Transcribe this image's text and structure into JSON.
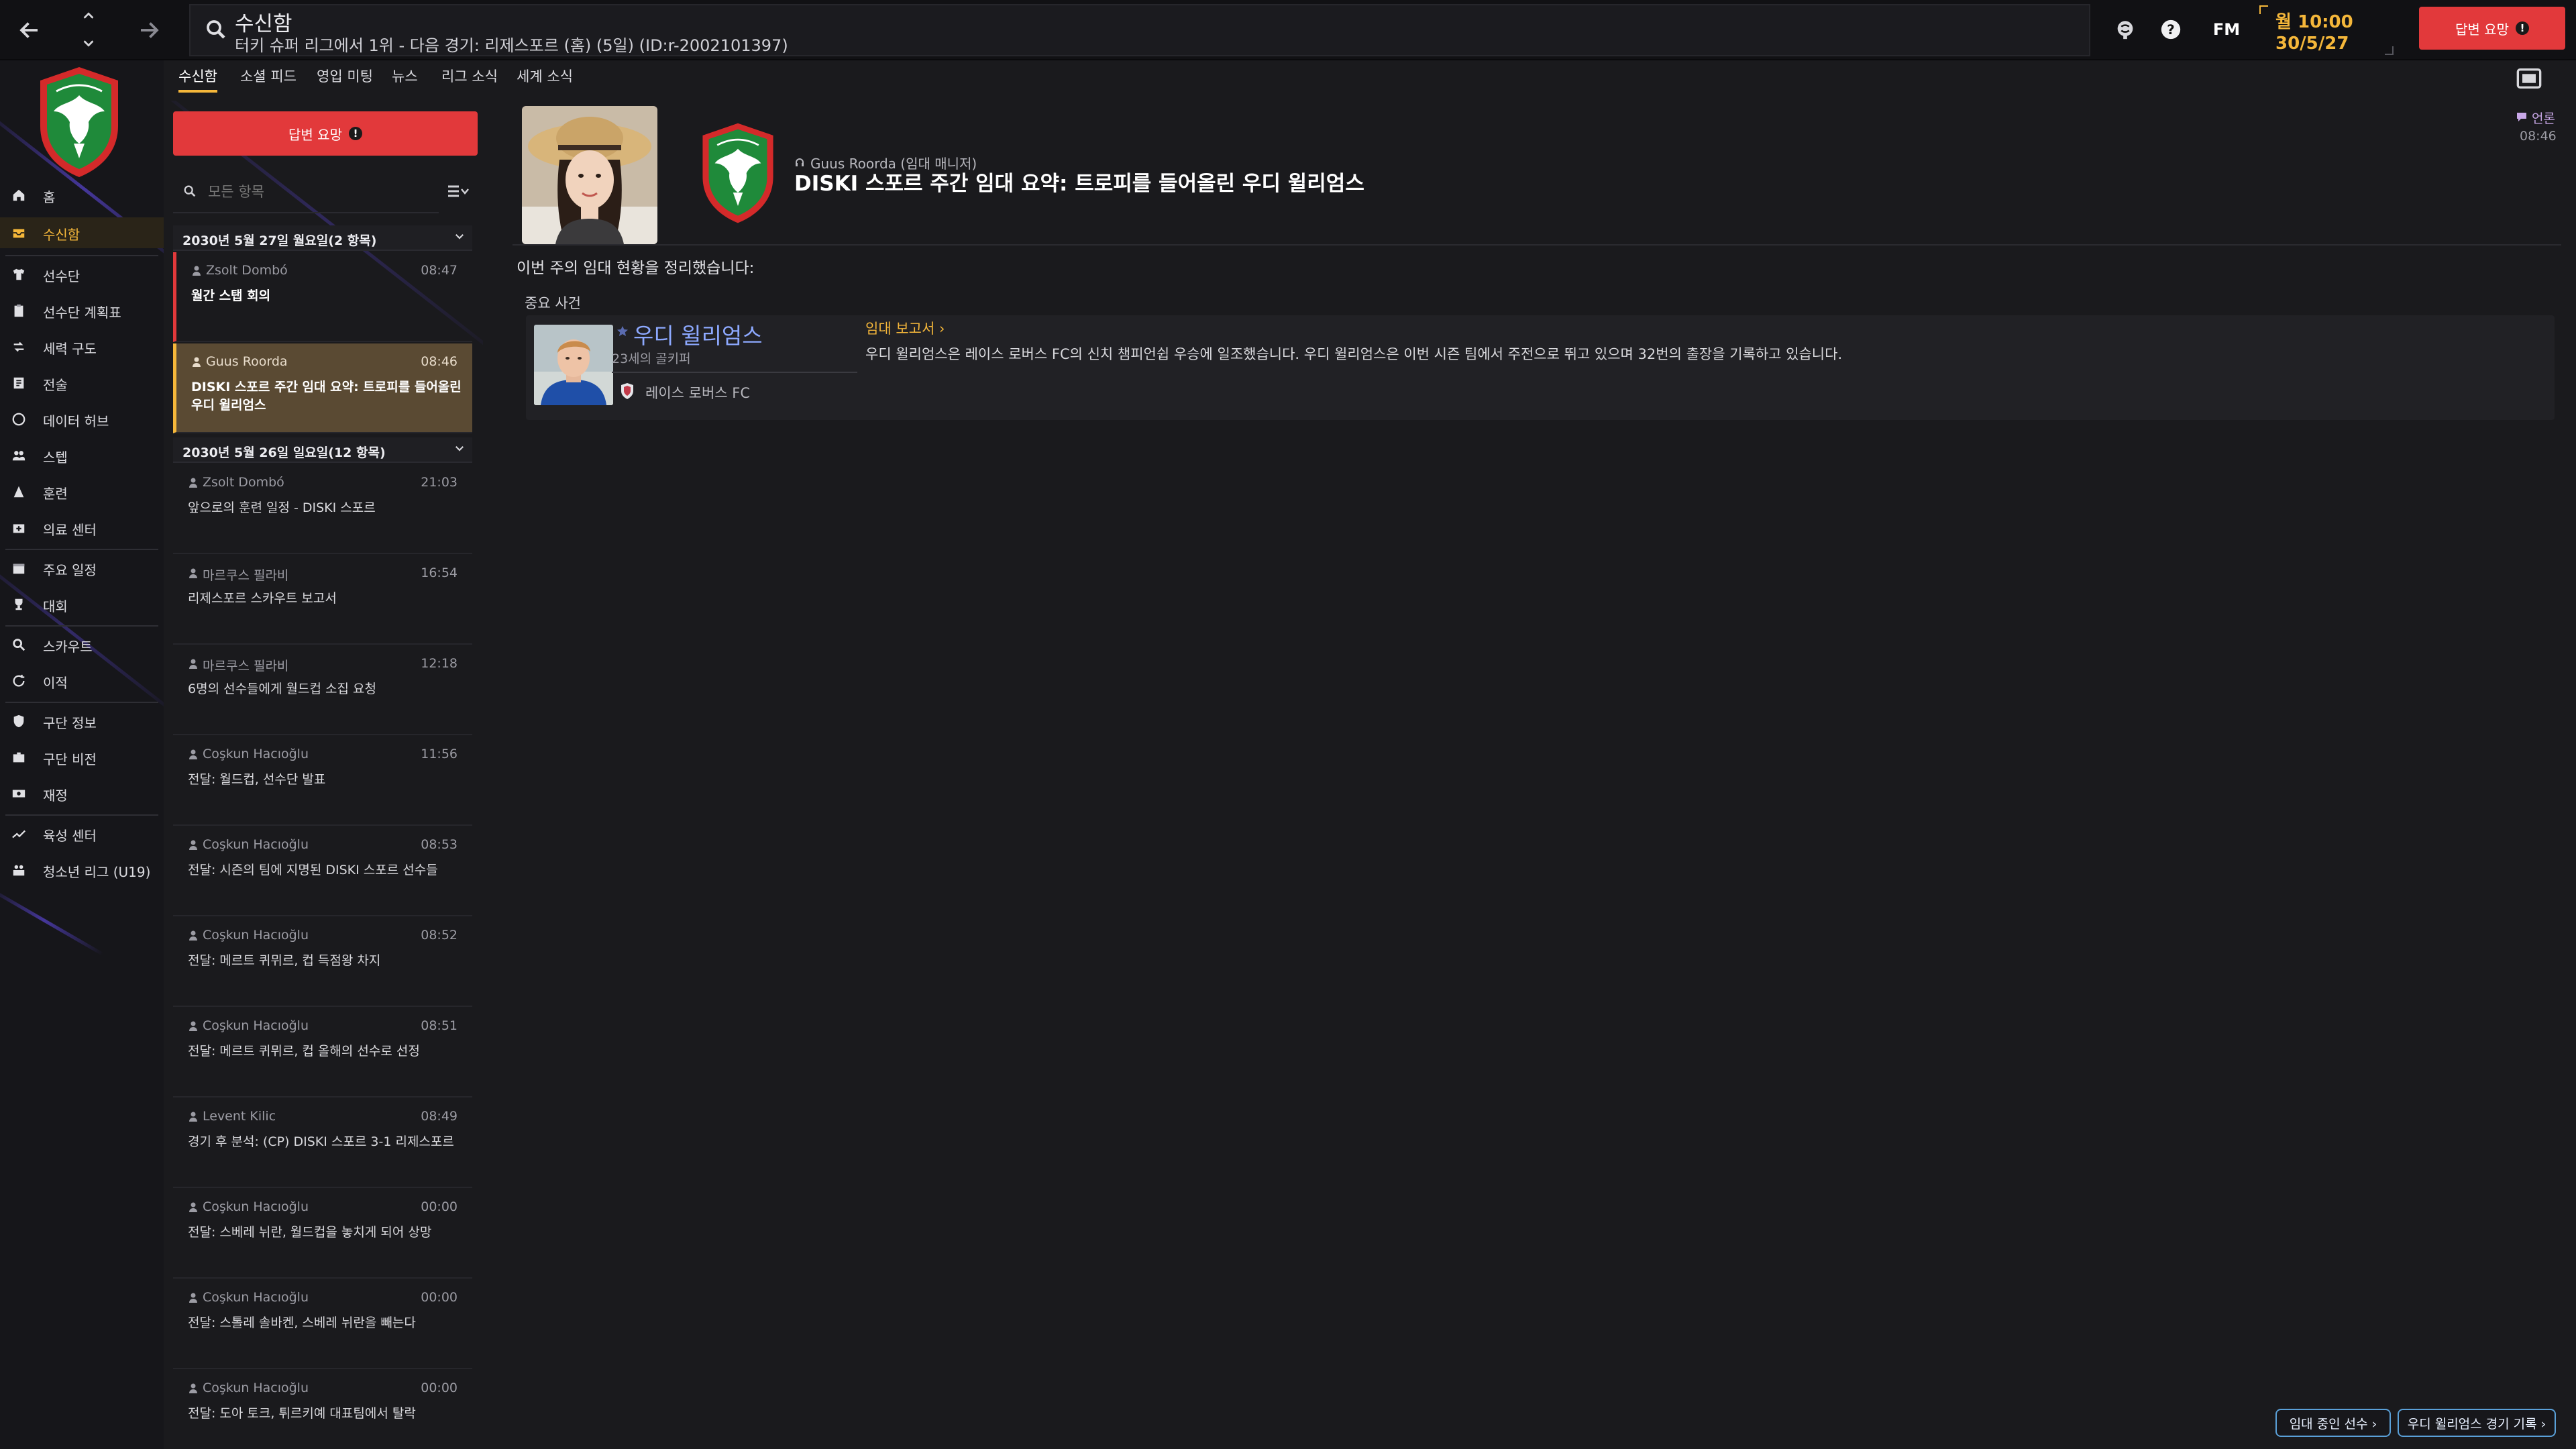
{
  "topbar": {
    "title": "수신함",
    "subtitle": "터키 슈퍼 리그에서 1위 - 다음 경기: 리제스포르 (홈) (5일) (ID:r-2002101397)",
    "fm_label": "FM",
    "time": "월 10:00",
    "date": "30/5/27",
    "continue_label": "답변 요망",
    "alert_mark": "!"
  },
  "sidebar": {
    "items": [
      {
        "label": "홈",
        "icon": "home-icon"
      },
      {
        "label": "수신함",
        "icon": "inbox-icon",
        "active": true
      },
      {
        "label": "선수단",
        "icon": "shirt-icon"
      },
      {
        "label": "선수단 계획표",
        "icon": "clipboard-icon"
      },
      {
        "label": "세력 구도",
        "icon": "dynamics-icon"
      },
      {
        "label": "전술",
        "icon": "tactics-icon"
      },
      {
        "label": "데이터 허브",
        "icon": "data-hub-icon"
      },
      {
        "label": "스텝",
        "icon": "staff-icon"
      },
      {
        "label": "훈련",
        "icon": "training-icon"
      },
      {
        "label": "의료 센터",
        "icon": "medical-icon"
      },
      {
        "label": "주요 일정",
        "icon": "calendar-icon"
      },
      {
        "label": "대회",
        "icon": "trophy-icon"
      },
      {
        "label": "스카우트",
        "icon": "scout-icon"
      },
      {
        "label": "이적",
        "icon": "transfer-icon"
      },
      {
        "label": "구단 정보",
        "icon": "club-info-icon"
      },
      {
        "label": "구단 비전",
        "icon": "club-vision-icon"
      },
      {
        "label": "재정",
        "icon": "finance-icon"
      },
      {
        "label": "육성 센터",
        "icon": "development-icon"
      },
      {
        "label": "청소년 리그 (U19)",
        "icon": "youth-icon"
      }
    ]
  },
  "tabs": [
    "수신함",
    "소셜 피드",
    "영입 미팅",
    "뉴스",
    "리그 소식",
    "세계 소식"
  ],
  "list": {
    "continue_label": "답변 요망",
    "search_placeholder": "모든 항목",
    "groups": [
      {
        "header": "2030년 5월 27일 월요일(2 항목)",
        "messages": [
          {
            "sender": "Zsolt Dombó",
            "time": "08:47",
            "subject": "월간 스탭 회의",
            "state": "unread"
          },
          {
            "sender": "Guus Roorda",
            "time": "08:46",
            "subject": "DISKI 스포르 주간 임대 요약: 트로피를 들어올린 우디 윌리엄스",
            "state": "selected"
          }
        ]
      },
      {
        "header": "2030년 5월 26일 일요일(12 항목)",
        "messages": [
          {
            "sender": "Zsolt Dombó",
            "time": "21:03",
            "subject": "앞으로의 훈련 일정 - DISKI 스포르",
            "state": ""
          },
          {
            "sender": "마르쿠스 필라비",
            "time": "16:54",
            "subject": "리제스포르 스카우트 보고서",
            "state": ""
          },
          {
            "sender": "마르쿠스 필라비",
            "time": "12:18",
            "subject": "6명의 선수들에게 월드컵 소집 요청",
            "state": ""
          },
          {
            "sender": "Coşkun Hacıoğlu",
            "time": "11:56",
            "subject": "전달: 월드컵, 선수단 발표",
            "state": ""
          },
          {
            "sender": "Coşkun Hacıoğlu",
            "time": "08:53",
            "subject": "전달: 시즌의 팀에 지명된 DISKI 스포르 선수들",
            "state": ""
          },
          {
            "sender": "Coşkun Hacıoğlu",
            "time": "08:52",
            "subject": "전달: 메르트 퀴뮈르, 컵 득점왕 차지",
            "state": ""
          },
          {
            "sender": "Coşkun Hacıoğlu",
            "time": "08:51",
            "subject": "전달: 메르트 퀴뮈르, 컵 올해의 선수로 선정",
            "state": ""
          },
          {
            "sender": "Levent Kilic",
            "time": "08:49",
            "subject": "경기 후 분석: (CP) DISKI 스포르 3-1 리제스포르",
            "state": ""
          },
          {
            "sender": "Coşkun Hacıoğlu",
            "time": "00:00",
            "subject": "전달: 스베레 뉘란, 월드컵을 놓치게 되어 상망",
            "state": ""
          },
          {
            "sender": "Coşkun Hacıoğlu",
            "time": "00:00",
            "subject": "전달: 스톨레 솔바켄, 스베레 뉘란을 빼는다",
            "state": ""
          },
          {
            "sender": "Coşkun Hacıoğlu",
            "time": "00:00",
            "subject": "전달: 도아 토크, 튀르키예 대표팀에서 탈락",
            "state": ""
          }
        ]
      }
    ]
  },
  "detail": {
    "sender_line": "Guus Roorda (임대 매니저)",
    "subject": "DISKI 스포르 주간 임대 요약: 트로피를 들어올린 우디 윌리엄스",
    "reaction": "언론",
    "time": "08:46",
    "intro": "이번 주의 임대 현황을 정리했습니다:",
    "events_heading": "중요 사건",
    "event": {
      "player_name": "우디 윌리엄스",
      "player_info": "23세의 골키퍼",
      "player_club": "레이스 로버스 FC",
      "report_link": "임대 보고서 ›",
      "text": "우디 윌리엄스은 레이스 로버스 FC의 신치 챔피언쉽 우승에 일조했습니다. 우디 윌리엄스은 이번 시즌 팀에서 주전으로 뛰고 있으며 32번의 출장을 기록하고 있습니다."
    }
  },
  "bottom": {
    "loan_players": "임대 중인 선수 ›",
    "player_record": "우디 윌리엄스 경기 기록 ›"
  },
  "colors": {
    "accent": "#f5b73a",
    "alert": "#e2393b",
    "link": "#8da9ff",
    "club_green": "#1f8a3a",
    "club_red": "#d42a2a"
  }
}
